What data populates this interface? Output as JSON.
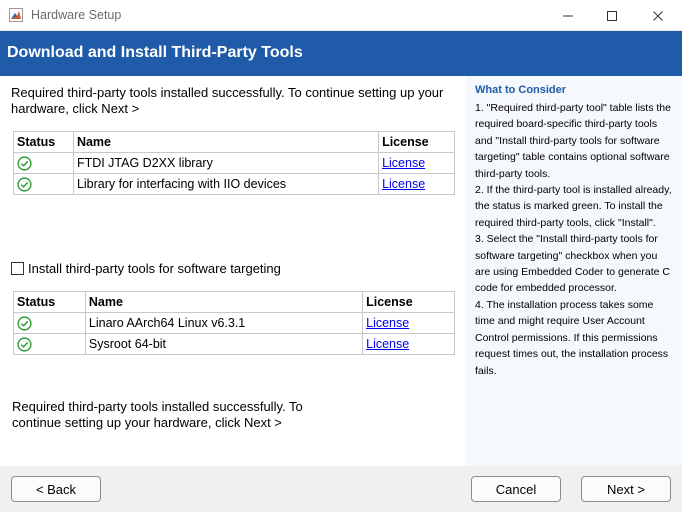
{
  "window": {
    "title": "Hardware Setup",
    "icon": "matlab-logo-icon",
    "controls": [
      "minimize-icon",
      "maximize-icon",
      "close-icon"
    ]
  },
  "banner": {
    "title": "Download and Install Third-Party Tools",
    "color": "#1f5ba8"
  },
  "main": {
    "intro": "Required third-party tools installed successfully. To continue setting up your hardware, click Next >",
    "required_table": {
      "headers": [
        "Status",
        "Name",
        "License"
      ],
      "rows": [
        {
          "status": "installed",
          "name": "FTDI JTAG D2XX library",
          "license": "License"
        },
        {
          "status": "installed",
          "name": "Library for interfacing with IIO devices",
          "license": "License"
        }
      ]
    },
    "optional_checkbox": {
      "label": "Install third-party tools for software targeting",
      "checked": false
    },
    "optional_table": {
      "headers": [
        "Status",
        "Name",
        "License"
      ],
      "rows": [
        {
          "status": "installed",
          "name": "Linaro AArch64 Linux v6.3.1",
          "license": "License"
        },
        {
          "status": "installed",
          "name": "Sysroot 64-bit",
          "license": "License"
        }
      ]
    },
    "outro": "Required third-party tools installed successfully. To continue setting up your hardware, click Next >"
  },
  "sidebar": {
    "heading": "What to Consider",
    "items": [
      "1. \"Required third-party tool\" table lists the required board-specific third-party tools and \"Install third-party tools for software targeting\" table contains optional software third-party tools.",
      "2. If the third-party tool is installed already, the status is marked green. To install the required third-party tools, click \"Install\".",
      "3. Select the \"Install third-party tools for software targeting\" checkbox when you are using Embedded Coder to generate C code for embedded processor.",
      "4. The installation process takes some time and might require User Account Control permissions. If this permissions request times out, the installation process fails."
    ]
  },
  "footer": {
    "back_label": "< Back",
    "cancel_label": "Cancel",
    "next_label": "Next >"
  },
  "colors": {
    "status_ok": "#2e9e3a",
    "link": "#0000ee",
    "sidebar_bg": "#f5f8fc"
  }
}
